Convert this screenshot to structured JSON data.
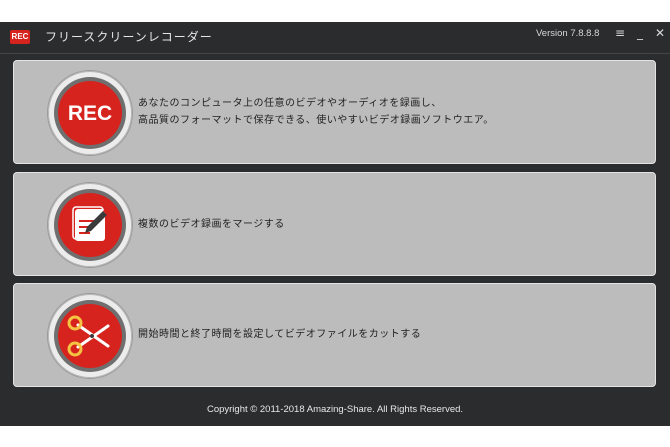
{
  "titlebar": {
    "logo_text": "REC",
    "title": "フリースクリーンレコーダー",
    "version": "Version 7.8.8.8",
    "menu_icon": "≡",
    "minimize_icon": "_",
    "close_icon": "✕"
  },
  "cards": [
    {
      "icon": "rec-icon",
      "icon_text": "REC",
      "lines": [
        "あなたのコンピュータ上の任意のビデオやオーディオを録画し、",
        "高品質のフォーマットで保存できる、使いやすいビデオ録画ソフトウエア。"
      ]
    },
    {
      "icon": "merge-document-icon",
      "lines": [
        "複数のビデオ録画をマージする"
      ]
    },
    {
      "icon": "scissors-icon",
      "lines": [
        "開始時間と終了時間を設定してビデオファイルをカットする"
      ]
    }
  ],
  "footer": {
    "copyright": "Copyright © 2011-2018 Amazing-Share. All Rights Reserved."
  },
  "colors": {
    "accent_red": "#d6231e",
    "window_bg": "#2b2c2e",
    "card_bg": "#bcbcbc"
  }
}
